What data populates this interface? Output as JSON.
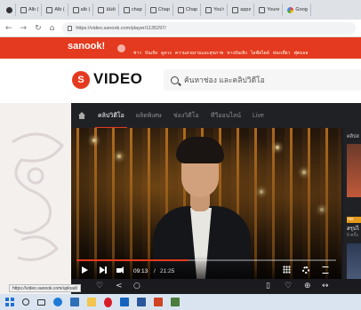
{
  "browser": {
    "tabs": [
      {
        "label": "Alb (",
        "icon": "page-icon"
      },
      {
        "label": "Alb (",
        "icon": "page-icon"
      },
      {
        "label": "alb (",
        "icon": "page-icon"
      },
      {
        "label": "อมต",
        "icon": "page-icon"
      },
      {
        "label": "chap",
        "icon": "page-icon"
      },
      {
        "label": "Chap",
        "icon": "page-icon"
      },
      {
        "label": "Chap",
        "icon": "page-icon"
      },
      {
        "label": "You'r",
        "icon": "page-icon"
      },
      {
        "label": "appz",
        "icon": "page-icon"
      },
      {
        "label": "Youre",
        "icon": "page-icon"
      },
      {
        "label": "Goog",
        "icon": "google-icon"
      }
    ],
    "url": "https://video.sanook.com/player/1135297/",
    "status_url": "https://video.sanook.com/upload/"
  },
  "site": {
    "logo": "sanook!",
    "nav_items": [
      "ข่าว",
      "บันเทิง",
      "ดูดวง",
      "ความสวยงามและสุขภาพ",
      "ทางบันเทิง",
      "ไลฟ์สไตล์",
      "ท่องเที่ยว",
      "ฟุตบอล"
    ],
    "brand_mark": "S",
    "brand_text": "VIDEO",
    "search_placeholder": "ค้นหาช่อง และคลิปวิดีโอ"
  },
  "video_nav": {
    "tabs": [
      "คลิปวิดีโอ",
      "ผลิตพิเศษ",
      "ช่องวิดีโอ",
      "ทีวีออนไลน์",
      "Live"
    ],
    "active_index": 0
  },
  "player": {
    "time_current": "09:13",
    "time_separator": "/",
    "time_total": "21:25",
    "progress": 0.43
  },
  "sidebar": {
    "label": "คลิปส",
    "badge": "HD",
    "title": "สรุปไ",
    "views": "0 ครั้ง"
  },
  "colors": {
    "brand": "#e43a1f",
    "dark_bg": "#1b1b1f"
  }
}
